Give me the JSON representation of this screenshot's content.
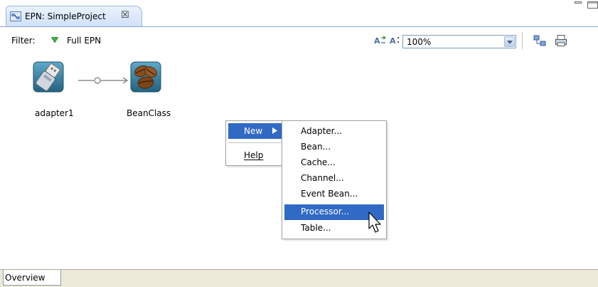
{
  "editor": {
    "tab_title": "EPN: SimpleProject",
    "tab_icon": "epn-diagram-icon",
    "close_glyph": "☒"
  },
  "toolbar": {
    "filter_label": "Filter:",
    "filter_value": "Full EPN",
    "zoom_value": "100%"
  },
  "canvas": {
    "nodes": [
      {
        "label": "adapter1",
        "icon": "usb-adapter-icon"
      },
      {
        "label": "BeanClass",
        "icon": "coffee-bean-icon"
      }
    ]
  },
  "context_menu": {
    "items": [
      {
        "label": "New",
        "has_submenu": true,
        "highlighted": true
      },
      {
        "label": "Help",
        "mnemonic": "H"
      }
    ]
  },
  "submenu": {
    "items": [
      {
        "label": "Adapter..."
      },
      {
        "label": "Bean..."
      },
      {
        "label": "Cache..."
      },
      {
        "label": "Channel..."
      },
      {
        "label": "Event Bean..."
      },
      {
        "label": "Processor...",
        "highlighted": true
      },
      {
        "label": "Table..."
      }
    ]
  },
  "bottom_tabs": {
    "overview_label": "Overview"
  },
  "colors": {
    "selection": "#316ac5",
    "tab_border": "#9bb5dc",
    "bottom_bar": "#ece9d8"
  }
}
